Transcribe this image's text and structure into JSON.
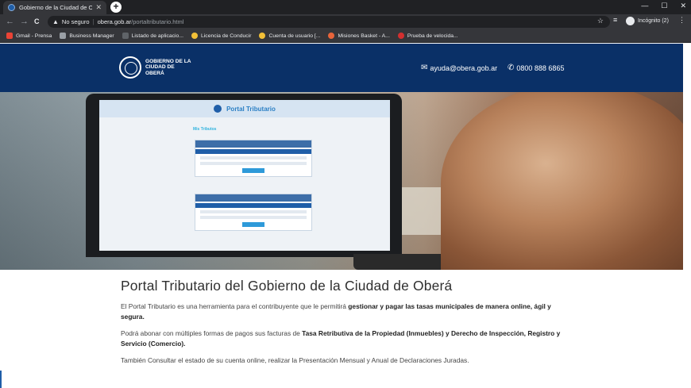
{
  "browser": {
    "tab_title": "Gobierno de la Ciudad de Oberá",
    "tab_close": "✕",
    "new_tab": "+",
    "window_controls": [
      "—",
      "☐",
      "✕"
    ],
    "nav": {
      "back": "←",
      "forward": "→",
      "reload": "C"
    },
    "security_label": "No seguro",
    "url_host": "obera.gob.ar",
    "url_path": "/portaltributario.html",
    "profile_label": "Incógnito (2)",
    "bookmarks": [
      {
        "label": "Gmail - Prensa",
        "icon": "gmail-icon",
        "color": "#ea4335"
      },
      {
        "label": "Business Manager",
        "icon": "briefcase-icon",
        "color": "#9aa0a6"
      },
      {
        "label": "Listado de aplicacio...",
        "icon": "bird-icon",
        "color": "#5f6368"
      },
      {
        "label": "Licencia de Conducir",
        "icon": "seal-icon",
        "color": "#f2c037"
      },
      {
        "label": "Cuenta de usuario [...",
        "icon": "seal-icon",
        "color": "#f2c037"
      },
      {
        "label": "Misiones Basket - A...",
        "icon": "ball-icon",
        "color": "#e8643a"
      },
      {
        "label": "Prueba de velocida...",
        "icon": "speed-icon",
        "color": "#d32f2f"
      }
    ]
  },
  "header": {
    "logo_text": "GOBIERNO DE LA CIUDAD DE OBERÁ",
    "email": "ayuda@obera.gob.ar",
    "phone": "0800 888 6865",
    "bg_color": "#0a3067"
  },
  "hero": {
    "screen_title": "Portal Tributario",
    "screen_section": "Mis Tributos"
  },
  "content": {
    "title": "Portal Tributario del Gobierno de la Ciudad de Oberá",
    "p1_a": "El Portal Tributario es una herramienta para el contribuyente que le permitirá ",
    "p1_b": "gestionar y pagar las tasas municipales de manera online, ágil y segura.",
    "p2_a": "Podrá abonar con múltiples formas de pagos sus facturas de ",
    "p2_b": "Tasa Retributiva de la Propiedad (Inmuebles) y Derecho de Inspección, Registro y Servicio (Comercio).",
    "p3": "También Consultar el estado de su cuenta online, realizar la Presentación Mensual y Anual de Declaraciones Juradas."
  }
}
